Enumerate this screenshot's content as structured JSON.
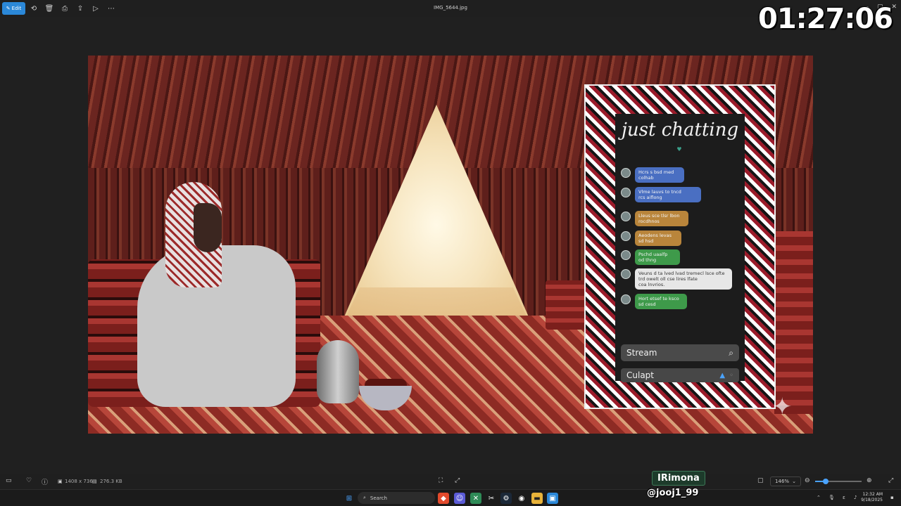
{
  "window": {
    "file_title": "IMG_5644.jpg",
    "edit_label": "Edit",
    "controls": [
      "—",
      "▢",
      "✕"
    ]
  },
  "toolbar": {
    "icons": [
      "rotate-icon",
      "delete-icon",
      "print-icon",
      "share-icon",
      "slideshow-icon",
      "more-icon"
    ]
  },
  "stream_overlay": {
    "timer": "01:27:06",
    "name": "IRimona",
    "handle": "@jooj1_99"
  },
  "chat_panel": {
    "title": "just chatting",
    "messages": [
      {
        "text": "Hcrs s bsd med\ncolhab",
        "color": "blue"
      },
      {
        "text": "Vlme lauvs to tncd\nrcs aiflong",
        "color": "blue"
      },
      {
        "text": "Lleus sce tlsr lbon\nrocdhnos",
        "color": "orange"
      },
      {
        "text": "Aeodens levas\nsd hsd",
        "color": "orange"
      },
      {
        "text": "Pschd uaalfp\nod thng",
        "color": "green"
      },
      {
        "text": "Veuns d ta lved lvad tremecl lsce ofte\ntrd owelt oll cse lires lfate\ncoa lnvrios.",
        "color": "white"
      },
      {
        "text": "Hort etsef te ksco\nsd cesd",
        "color": "green"
      }
    ],
    "stream_label": "Stream",
    "culapt_label": "Culapt"
  },
  "statusbar": {
    "dimensions": "1408 x 736",
    "filesize": "276.3 KB",
    "zoom": "146%",
    "zoom_level": 0.22
  },
  "taskbar": {
    "search_placeholder": "Search",
    "time": "12:32 AM",
    "date": "9/18/2025"
  }
}
